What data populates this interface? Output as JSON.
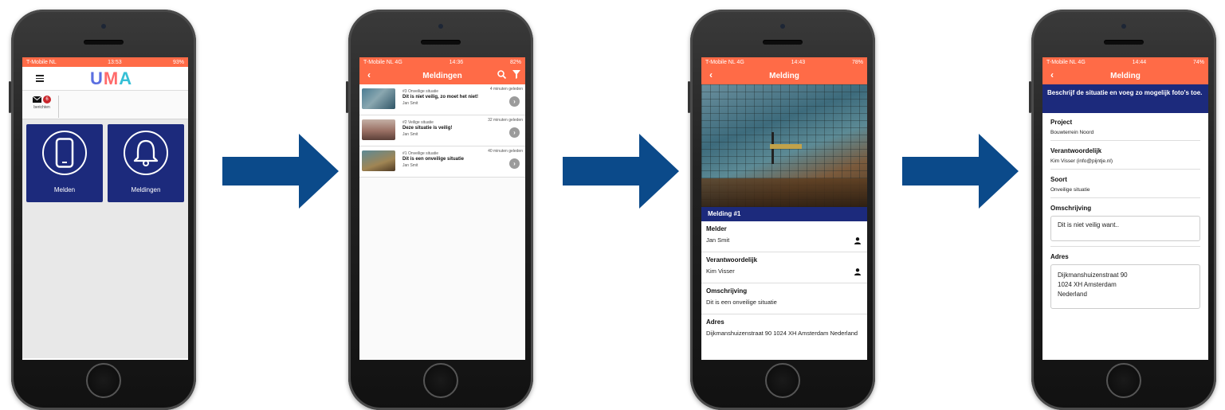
{
  "status_bars": [
    {
      "carrier": "T-Mobile NL",
      "time": "13:53",
      "battery": "93%"
    },
    {
      "carrier": "T-Mobile NL  4G",
      "time": "14:36",
      "battery": "82%"
    },
    {
      "carrier": "T-Mobile NL  4G",
      "time": "14:43",
      "battery": "78%"
    },
    {
      "carrier": "T-Mobile NL  4G",
      "time": "14:44",
      "battery": "74%"
    }
  ],
  "screen1": {
    "logo_u": "U",
    "logo_m": "M",
    "logo_a": "A",
    "messages_count": "6",
    "messages_label": "berichten",
    "tile_melden": "Melden",
    "tile_meldingen": "Meldingen"
  },
  "screen2": {
    "title": "Meldingen",
    "items": [
      {
        "time": "4 minuten geleden",
        "type": "#3 Onveilige situatie",
        "title": "Dit is niet veilig, zo moet het niet!",
        "name": "Jan Smit"
      },
      {
        "time": "32 minuten geleden",
        "type": "#2 Veilige situatie",
        "title": "Deze situatie is veilig!",
        "name": "Jan Smit"
      },
      {
        "time": "40 minuten geleden",
        "type": "#1 Onveilige situatie",
        "title": "Dit is een onveilige situatie",
        "name": "Jan Smit"
      }
    ]
  },
  "screen3": {
    "title": "Melding",
    "banner": "Melding #1",
    "melder_label": "Melder",
    "melder_value": "Jan Smit",
    "verantwoordelijk_label": "Verantwoordelijk",
    "verantwoordelijk_value": "Kim Visser",
    "omschrijving_label": "Omschrijving",
    "omschrijving_value": "Dit is een onveilige situatie",
    "adres_label": "Adres",
    "adres_value": "Dijkmanshuizenstraat 90 1024 XH Amsterdam Nederland"
  },
  "screen4": {
    "title": "Melding",
    "instruction": "Beschrijf de situatie en voeg zo mogelijk foto's toe.",
    "project_label": "Project",
    "project_value": "Bouwterrein Noord",
    "verantwoordelijk_label": "Verantwoordelijk",
    "verantwoordelijk_value": "Kim Visser (info@pijntje.nl)",
    "soort_label": "Soort",
    "soort_value": "Onveilige situatie",
    "omschrijving_label": "Omschrijving",
    "omschrijving_value": "Dit is niet veilig want..",
    "adres_label": "Adres",
    "adres_line1": "Dijkmanshuizenstraat 90",
    "adres_line2": "1024 XH Amsterdam",
    "adres_line3": "Nederland"
  },
  "colors": {
    "accent": "#ff6b47",
    "navy": "#1c2a7c",
    "arrow": "#0b4a8a"
  }
}
